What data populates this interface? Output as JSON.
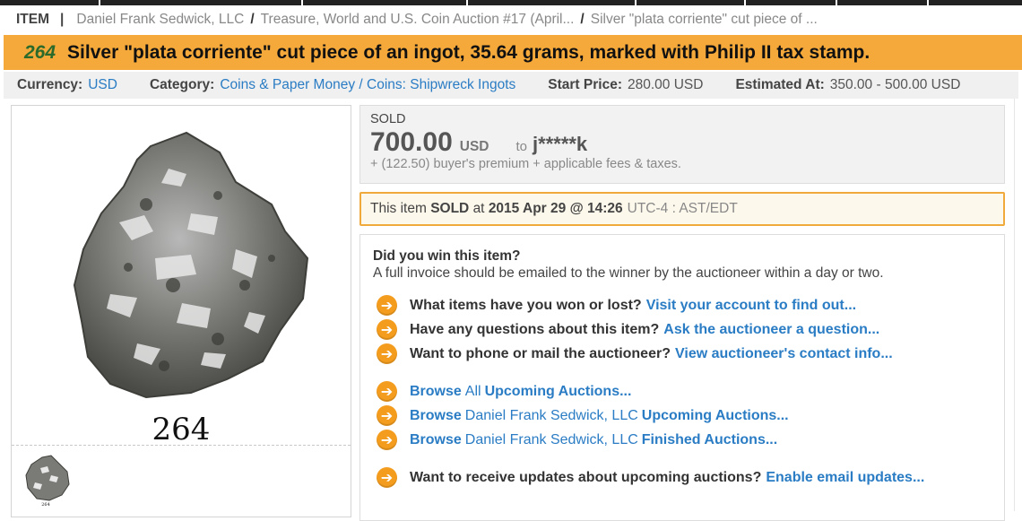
{
  "breadcrumb": {
    "item_label": "ITEM",
    "links": [
      "Daniel Frank Sedwick, LLC",
      "Treasure, World and U.S. Coin Auction #17 (April...",
      "Silver \"plata corriente\" cut piece of ..."
    ]
  },
  "title": {
    "lot_number": "264",
    "text": "Silver \"plata corriente\" cut piece of an ingot, 35.64 grams, marked with Philip II tax stamp."
  },
  "meta": {
    "currency_label": "Currency:",
    "currency": "USD",
    "category_label": "Category:",
    "category": "Coins & Paper Money / Coins: Shipwreck Ingots",
    "start_price_label": "Start Price:",
    "start_price": "280.00 USD",
    "estimated_label": "Estimated At:",
    "estimated": "350.00 - 500.00 USD"
  },
  "image": {
    "caption": "264",
    "thumb_caption": "264"
  },
  "sold": {
    "label": "SOLD",
    "price": "700.00",
    "currency": "USD",
    "to_label": "to",
    "buyer": "j*****k",
    "premium": "+ (122.50) buyer's premium + applicable fees & taxes."
  },
  "sold_at": {
    "prefix": "This item",
    "sold_word": "SOLD",
    "at_word": "at",
    "datetime": "2015 Apr 29 @ 14:26",
    "timezone": "UTC-4 : AST/EDT"
  },
  "info": {
    "question": "Did you win this item?",
    "subtitle": "A full invoice should be emailed to the winner by the auctioneer within a day or two.",
    "rows": [
      {
        "text": "What items have you won or lost?",
        "link": "Visit your account to find out..."
      },
      {
        "text": "Have any questions about this item?",
        "link": "Ask the auctioneer a question..."
      },
      {
        "text": "Want to phone or mail the auctioneer?",
        "link": "View auctioneer's contact info..."
      }
    ],
    "browse": [
      {
        "browse": "Browse",
        "mid": "All",
        "link": "Upcoming Auctions..."
      },
      {
        "browse": "Browse",
        "mid": "Daniel Frank Sedwick, LLC",
        "link": "Upcoming Auctions..."
      },
      {
        "browse": "Browse",
        "mid": "Daniel Frank Sedwick, LLC",
        "link": "Finished Auctions..."
      }
    ],
    "updates": {
      "text": "Want to receive updates about upcoming auctions?",
      "link": "Enable email updates..."
    }
  },
  "colors": {
    "accent_orange": "#f5a93b",
    "link_blue": "#2a7cc4",
    "lot_green": "#2b6a2b",
    "icon_orange": "#f39c1e"
  }
}
